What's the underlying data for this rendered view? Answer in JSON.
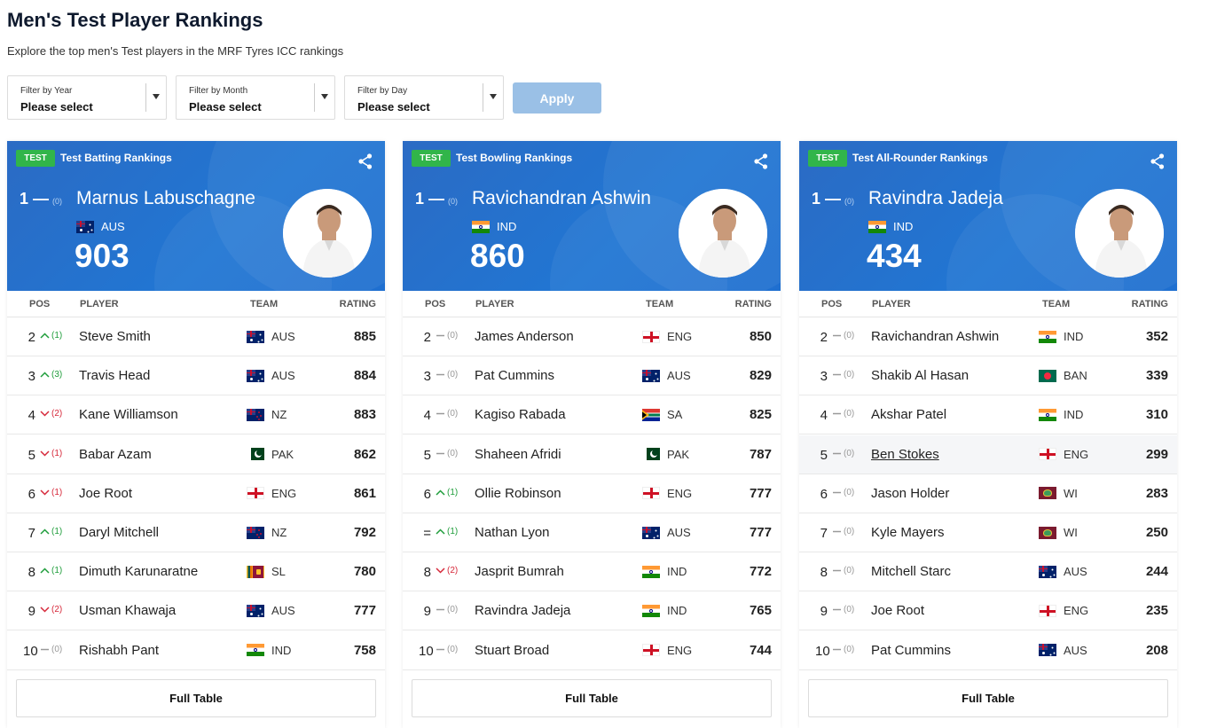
{
  "page": {
    "title": "Men's Test Player Rankings",
    "subtitle": "Explore the top men's Test players in the MRF Tyres ICC rankings"
  },
  "filters": [
    {
      "label": "Filter by Year",
      "value": "Please select"
    },
    {
      "label": "Filter by Month",
      "value": "Please select"
    },
    {
      "label": "Filter by Day",
      "value": "Please select"
    }
  ],
  "apply_label": "Apply",
  "table_headers": {
    "pos": "POS",
    "player": "PLAYER",
    "team": "TEAM",
    "rating": "RATING"
  },
  "full_table_label": "Full Table",
  "colors": {
    "hero": "#2176d3",
    "badge": "#31b54a",
    "up": "#1f9d3b",
    "down": "#d6283a",
    "apply": "#9ac0e6"
  },
  "cards": [
    {
      "badge": "TEST",
      "title": "Test Batting Rankings",
      "top": {
        "pos": "1",
        "move": "(0)",
        "name": "Marnus Labuschagne",
        "team": "AUS",
        "flag": "aus",
        "rating": "903"
      },
      "rows": [
        {
          "pos": "2",
          "dir": "up",
          "move": "(1)",
          "name": "Steve Smith",
          "team": "AUS",
          "flag": "aus",
          "rating": "885"
        },
        {
          "pos": "3",
          "dir": "up",
          "move": "(3)",
          "name": "Travis Head",
          "team": "AUS",
          "flag": "aus",
          "rating": "884"
        },
        {
          "pos": "4",
          "dir": "down",
          "move": "(2)",
          "name": "Kane Williamson",
          "team": "NZ",
          "flag": "nz",
          "rating": "883"
        },
        {
          "pos": "5",
          "dir": "down",
          "move": "(1)",
          "name": "Babar Azam",
          "team": "PAK",
          "flag": "pak",
          "rating": "862"
        },
        {
          "pos": "6",
          "dir": "down",
          "move": "(1)",
          "name": "Joe Root",
          "team": "ENG",
          "flag": "eng",
          "rating": "861"
        },
        {
          "pos": "7",
          "dir": "up",
          "move": "(1)",
          "name": "Daryl Mitchell",
          "team": "NZ",
          "flag": "nz",
          "rating": "792"
        },
        {
          "pos": "8",
          "dir": "up",
          "move": "(1)",
          "name": "Dimuth Karunaratne",
          "team": "SL",
          "flag": "sl",
          "rating": "780"
        },
        {
          "pos": "9",
          "dir": "down",
          "move": "(2)",
          "name": "Usman Khawaja",
          "team": "AUS",
          "flag": "aus",
          "rating": "777"
        },
        {
          "pos": "10",
          "dir": "same",
          "move": "(0)",
          "name": "Rishabh Pant",
          "team": "IND",
          "flag": "ind",
          "rating": "758"
        }
      ]
    },
    {
      "badge": "TEST",
      "title": "Test Bowling Rankings",
      "top": {
        "pos": "1",
        "move": "(0)",
        "name": "Ravichandran Ashwin",
        "team": "IND",
        "flag": "ind",
        "rating": "860"
      },
      "rows": [
        {
          "pos": "2",
          "dir": "same",
          "move": "(0)",
          "name": "James Anderson",
          "team": "ENG",
          "flag": "eng",
          "rating": "850"
        },
        {
          "pos": "3",
          "dir": "same",
          "move": "(0)",
          "name": "Pat Cummins",
          "team": "AUS",
          "flag": "aus",
          "rating": "829"
        },
        {
          "pos": "4",
          "dir": "same",
          "move": "(0)",
          "name": "Kagiso Rabada",
          "team": "SA",
          "flag": "sa",
          "rating": "825"
        },
        {
          "pos": "5",
          "dir": "same",
          "move": "(0)",
          "name": "Shaheen Afridi",
          "team": "PAK",
          "flag": "pak",
          "rating": "787"
        },
        {
          "pos": "6",
          "dir": "up",
          "move": "(1)",
          "name": "Ollie Robinson",
          "team": "ENG",
          "flag": "eng",
          "rating": "777"
        },
        {
          "pos": "=",
          "dir": "up",
          "move": "(1)",
          "name": "Nathan Lyon",
          "team": "AUS",
          "flag": "aus",
          "rating": "777"
        },
        {
          "pos": "8",
          "dir": "down",
          "move": "(2)",
          "name": "Jasprit Bumrah",
          "team": "IND",
          "flag": "ind",
          "rating": "772"
        },
        {
          "pos": "9",
          "dir": "same",
          "move": "(0)",
          "name": "Ravindra Jadeja",
          "team": "IND",
          "flag": "ind",
          "rating": "765"
        },
        {
          "pos": "10",
          "dir": "same",
          "move": "(0)",
          "name": "Stuart Broad",
          "team": "ENG",
          "flag": "eng",
          "rating": "744"
        }
      ]
    },
    {
      "badge": "TEST",
      "title": "Test All-Rounder Rankings",
      "top": {
        "pos": "1",
        "move": "(0)",
        "name": "Ravindra Jadeja",
        "team": "IND",
        "flag": "ind",
        "rating": "434"
      },
      "rows": [
        {
          "pos": "2",
          "dir": "same",
          "move": "(0)",
          "name": "Ravichandran Ashwin",
          "team": "IND",
          "flag": "ind",
          "rating": "352"
        },
        {
          "pos": "3",
          "dir": "same",
          "move": "(0)",
          "name": "Shakib Al Hasan",
          "team": "BAN",
          "flag": "ban",
          "rating": "339"
        },
        {
          "pos": "4",
          "dir": "same",
          "move": "(0)",
          "name": "Akshar Patel",
          "team": "IND",
          "flag": "ind",
          "rating": "310"
        },
        {
          "pos": "5",
          "dir": "same",
          "move": "(0)",
          "name": "Ben Stokes",
          "team": "ENG",
          "flag": "eng",
          "rating": "299",
          "hovered": true
        },
        {
          "pos": "6",
          "dir": "same",
          "move": "(0)",
          "name": "Jason Holder",
          "team": "WI",
          "flag": "wi",
          "rating": "283"
        },
        {
          "pos": "7",
          "dir": "same",
          "move": "(0)",
          "name": "Kyle Mayers",
          "team": "WI",
          "flag": "wi",
          "rating": "250"
        },
        {
          "pos": "8",
          "dir": "same",
          "move": "(0)",
          "name": "Mitchell Starc",
          "team": "AUS",
          "flag": "aus",
          "rating": "244"
        },
        {
          "pos": "9",
          "dir": "same",
          "move": "(0)",
          "name": "Joe Root",
          "team": "ENG",
          "flag": "eng",
          "rating": "235"
        },
        {
          "pos": "10",
          "dir": "same",
          "move": "(0)",
          "name": "Pat Cummins",
          "team": "AUS",
          "flag": "aus",
          "rating": "208"
        }
      ]
    }
  ]
}
